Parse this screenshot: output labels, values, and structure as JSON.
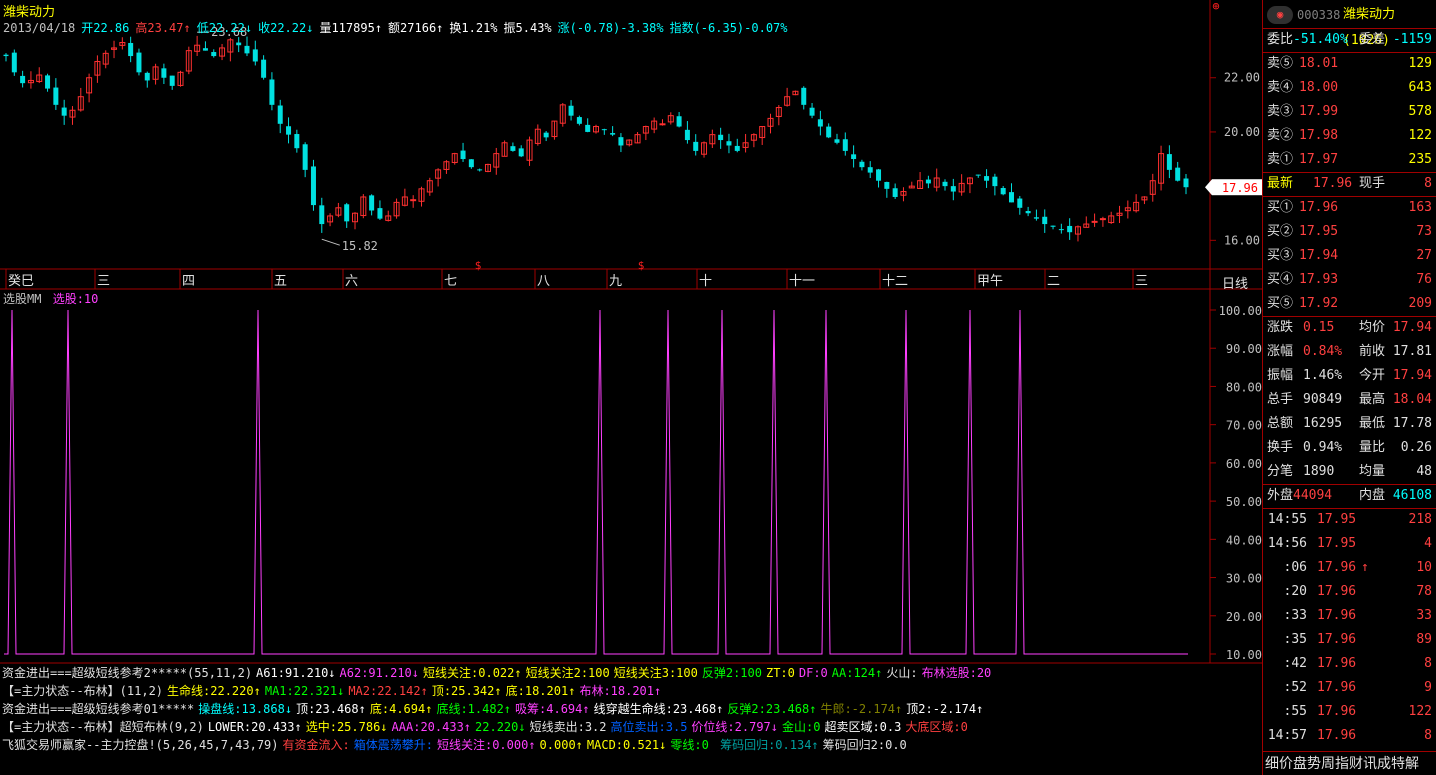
{
  "stock": {
    "name": "潍柴动力",
    "code": "000338",
    "name_full": "潍柴动力(1026)"
  },
  "info": {
    "date": "2013/04/18",
    "open": "开22.86",
    "high": "高23.47",
    "low": "低22.22",
    "close": "收22.22",
    "volume": "量117895",
    "amount": "额27166",
    "turnover": "换1.21%",
    "amplitude": "振5.43%",
    "change": "涨(-0.78)-3.38%",
    "index": "指数(-6.35)-0.07%"
  },
  "price_axis": {
    "labels": [
      "22.00",
      "20.00",
      "18.00",
      "16.00"
    ],
    "current": "17.96",
    "max_label": "23.68",
    "min_label": "15.82"
  },
  "month_axis": [
    "癸巳",
    "三",
    "四",
    "五",
    "六",
    "七",
    "八",
    "九",
    "十",
    "十一",
    "十二",
    "甲午",
    "二",
    "三"
  ],
  "period_label": "日线",
  "indicator": {
    "title": "选股MM",
    "value": "选股:10",
    "axis": [
      "100.00",
      "90.00",
      "80.00",
      "70.00",
      "60.00",
      "50.00",
      "40.00",
      "30.00",
      "20.00",
      "10.00"
    ]
  },
  "formula_lines": [
    [
      {
        "t": "资金进出===超级短线参考2*****(55,11,2)",
        "c": "#e0e0e0"
      },
      {
        "t": "A61:91.210↓",
        "c": "#ffffff"
      },
      {
        "t": "A62:91.210↓",
        "c": "#ff40ff"
      },
      {
        "t": "短线关注:0.022↑",
        "c": "#ffff00"
      },
      {
        "t": "短线关注2:100",
        "c": "#ffff00"
      },
      {
        "t": "短线关注3:100",
        "c": "#ffff00"
      },
      {
        "t": "反弹2:100",
        "c": "#00ff00"
      },
      {
        "t": "ZT:0",
        "c": "#ffff00"
      },
      {
        "t": "DF:0",
        "c": "#ff40ff"
      },
      {
        "t": "AA:124↑",
        "c": "#00ff00"
      },
      {
        "t": "火山:",
        "c": "#e0e0e0"
      },
      {
        "t": "布林选股:20",
        "c": "#ff40ff"
      }
    ],
    [
      {
        "t": "【=主力状态--布林】(11,2)",
        "c": "#e0e0e0"
      },
      {
        "t": "生命线:22.220↑",
        "c": "#ffff00"
      },
      {
        "t": "MA1:22.321↓",
        "c": "#00ff00"
      },
      {
        "t": "MA2:22.142↑",
        "c": "#ff4040"
      },
      {
        "t": "顶:25.342↑",
        "c": "#ffff00"
      },
      {
        "t": "底:18.201↑",
        "c": "#ffff00"
      },
      {
        "t": "布林:18.201↑",
        "c": "#ff40ff"
      }
    ],
    [
      {
        "t": "资金进出===超级短线参考01*****",
        "c": "#e0e0e0"
      },
      {
        "t": "操盘线:13.868↓",
        "c": "#00ffff"
      },
      {
        "t": "顶:23.468↑",
        "c": "#ffffff"
      },
      {
        "t": "底:4.694↑",
        "c": "#ffff00"
      },
      {
        "t": "底线:1.482↑",
        "c": "#00ff00"
      },
      {
        "t": "吸筹:4.694↑",
        "c": "#ff40ff"
      },
      {
        "t": "线穿越生命线:23.468↑",
        "c": "#ffffff"
      },
      {
        "t": "反弹2:23.468↑",
        "c": "#00ff00"
      },
      {
        "t": "牛郎:-2.174↑",
        "c": "#808000"
      },
      {
        "t": "顶2:-2.174↑",
        "c": "#ffffff"
      }
    ],
    [
      {
        "t": "【=主力状态--布林】超短布林(9,2)",
        "c": "#e0e0e0"
      },
      {
        "t": "LOWER:20.433↑",
        "c": "#ffffff"
      },
      {
        "t": "选中:25.786↓",
        "c": "#ffff00"
      },
      {
        "t": "AAA:20.433↑",
        "c": "#ff40ff"
      },
      {
        "t": "22.220↓",
        "c": "#00ff00"
      },
      {
        "t": "短线卖出:3.2",
        "c": "#e0e0e0"
      },
      {
        "t": "高位卖出:3.5",
        "c": "#0060ff"
      },
      {
        "t": "价位线:2.797↓",
        "c": "#ff40ff"
      },
      {
        "t": "金山:0",
        "c": "#00ff00"
      },
      {
        "t": "超卖区域:0.3",
        "c": "#ffffff"
      },
      {
        "t": "大底区域:0",
        "c": "#ff4040"
      }
    ],
    [
      {
        "t": "飞狐交易师赢家--主力控盘!(5,26,45,7,43,79)",
        "c": "#e0e0e0"
      },
      {
        "t": "有资金流入:",
        "c": "#ff4040"
      },
      {
        "t": "箱体震荡攀升:",
        "c": "#0060ff"
      },
      {
        "t": "短线关注:0.000↑",
        "c": "#ff40ff"
      },
      {
        "t": "0.000↑",
        "c": "#ffff00"
      },
      {
        "t": "MACD:0.521↓",
        "c": "#ffff00"
      },
      {
        "t": "零线:0",
        "c": "#00ff00"
      },
      {
        "t": "       筹码回归:0.134↑",
        "c": "#00a0a0"
      },
      {
        "t": "筹码回归2:0.0",
        "c": "#e0e0e0"
      }
    ]
  ],
  "quote": {
    "weibi_label": "委比",
    "weibi_value": "-51.40%",
    "weicha_label": "委差",
    "weicha_value": "-1159",
    "sells": [
      {
        "label": "卖⑤",
        "price": "18.01",
        "vol": "129"
      },
      {
        "label": "卖④",
        "price": "18.00",
        "vol": "643"
      },
      {
        "label": "卖③",
        "price": "17.99",
        "vol": "578"
      },
      {
        "label": "卖②",
        "price": "17.98",
        "vol": "122"
      },
      {
        "label": "卖①",
        "price": "17.97",
        "vol": "235"
      }
    ],
    "latest_label": "最新",
    "latest_value": "17.96",
    "hand_label": "现手",
    "hand_value": "8",
    "buys": [
      {
        "label": "买①",
        "price": "17.96",
        "vol": "163"
      },
      {
        "label": "买②",
        "price": "17.95",
        "vol": "73"
      },
      {
        "label": "买③",
        "price": "17.94",
        "vol": "27"
      },
      {
        "label": "买④",
        "price": "17.93",
        "vol": "76"
      },
      {
        "label": "买⑤",
        "price": "17.92",
        "vol": "209"
      }
    ],
    "stats": [
      {
        "l1": "涨跌",
        "v1": "0.15",
        "c1": "#ff4040",
        "l2": "均价",
        "v2": "17.94",
        "c2": "#ff4040"
      },
      {
        "l1": "涨幅",
        "v1": "0.84%",
        "c1": "#ff4040",
        "l2": "前收",
        "v2": "17.81",
        "c2": "#e0e0e0"
      },
      {
        "l1": "振幅",
        "v1": "1.46%",
        "c1": "#e0e0e0",
        "l2": "今开",
        "v2": "17.94",
        "c2": "#ff4040"
      },
      {
        "l1": "总手",
        "v1": "90849",
        "c1": "#e0e0e0",
        "l2": "最高",
        "v2": "18.04",
        "c2": "#ff4040"
      },
      {
        "l1": "总额",
        "v1": "16295",
        "c1": "#e0e0e0",
        "l2": "最低",
        "v2": "17.78",
        "c2": "#e0e0e0"
      },
      {
        "l1": "换手",
        "v1": "0.94%",
        "c1": "#e0e0e0",
        "l2": "量比",
        "v2": "0.26",
        "c2": "#e0e0e0"
      },
      {
        "l1": "分笔",
        "v1": "1890",
        "c1": "#e0e0e0",
        "l2": "均量",
        "v2": "48",
        "c2": "#e0e0e0"
      }
    ],
    "outer_label": "外盘",
    "outer_value": "44094",
    "inner_label": "内盘",
    "inner_value": "46108",
    "ticks": [
      {
        "time": "14:55",
        "price": "17.95",
        "arrow": "",
        "vol": "218"
      },
      {
        "time": "14:56",
        "price": "17.95",
        "arrow": "",
        "vol": "4"
      },
      {
        "time": ":06",
        "price": "17.96",
        "arrow": "↑",
        "vol": "10"
      },
      {
        "time": ":20",
        "price": "17.96",
        "arrow": "",
        "vol": "78"
      },
      {
        "time": ":33",
        "price": "17.96",
        "arrow": "",
        "vol": "33"
      },
      {
        "time": ":35",
        "price": "17.96",
        "arrow": "",
        "vol": "89"
      },
      {
        "time": ":42",
        "price": "17.96",
        "arrow": "",
        "vol": "8"
      },
      {
        "time": ":52",
        "price": "17.96",
        "arrow": "",
        "vol": "9"
      },
      {
        "time": ":55",
        "price": "17.96",
        "arrow": "",
        "vol": "122"
      },
      {
        "time": "14:57",
        "price": "17.96",
        "arrow": "",
        "vol": "8"
      }
    ],
    "bottom_tabs": "细价盘势周指财讯成特解"
  },
  "chart_data": [
    {
      "type": "candlestick",
      "title": "潍柴动力",
      "y_ticks": [
        16.0,
        18.0,
        20.0,
        22.0
      ],
      "ylim": [
        15.2,
        24.5
      ],
      "max": 23.68,
      "min": 15.82,
      "last": 17.96,
      "close_path": [
        22.8,
        22.2,
        21.8,
        21.9,
        22.1,
        21.6,
        21.0,
        20.6,
        20.8,
        21.3,
        22.0,
        22.6,
        22.9,
        23.1,
        23.3,
        22.8,
        22.2,
        21.9,
        22.4,
        22.0,
        21.7,
        22.2,
        23.0,
        23.2,
        23.0,
        22.8,
        23.1,
        23.4,
        23.2,
        22.9,
        22.6,
        22.0,
        21.0,
        20.3,
        19.9,
        19.4,
        18.6,
        17.3,
        16.6,
        16.9,
        17.2,
        16.7,
        17.0,
        17.6,
        17.1,
        16.8,
        16.9,
        17.4,
        17.6,
        17.5,
        17.9,
        18.2,
        18.6,
        18.9,
        19.2,
        19.0,
        18.7,
        18.6,
        18.8,
        19.2,
        19.6,
        19.3,
        19.1,
        19.7,
        20.1,
        19.8,
        20.4,
        21.0,
        20.6,
        20.3,
        20.0,
        20.2,
        20.1,
        19.9,
        19.5,
        19.7,
        19.9,
        20.2,
        20.4,
        20.3,
        20.6,
        20.2,
        19.7,
        19.3,
        19.6,
        19.9,
        19.7,
        19.5,
        19.3,
        19.6,
        19.9,
        20.2,
        20.5,
        20.9,
        21.3,
        21.5,
        21.0,
        20.6,
        20.2,
        19.8,
        19.6,
        19.3,
        19.0,
        18.7,
        18.5,
        18.2,
        17.9,
        17.6,
        17.8,
        18.0,
        18.2,
        18.1,
        18.3,
        18.0,
        17.8,
        18.1,
        18.3,
        18.4,
        18.2,
        18.0,
        17.7,
        17.4,
        17.2,
        17.0,
        16.8,
        16.6,
        16.5,
        16.4,
        16.3,
        16.5,
        16.6,
        16.7,
        16.8,
        16.9,
        17.0,
        17.2,
        17.4,
        17.6,
        18.2,
        19.2,
        18.6,
        18.2,
        17.96
      ],
      "markers": [
        "$",
        "$"
      ]
    },
    {
      "type": "line",
      "title": "选股MM",
      "series": [
        {
          "name": "选股",
          "last": 10
        }
      ],
      "y_ticks": [
        10,
        20,
        30,
        40,
        50,
        60,
        70,
        80,
        90,
        100
      ],
      "ylim": [
        10,
        100
      ],
      "baseline": 10,
      "spike_value": 100,
      "spike_count": 12
    }
  ]
}
